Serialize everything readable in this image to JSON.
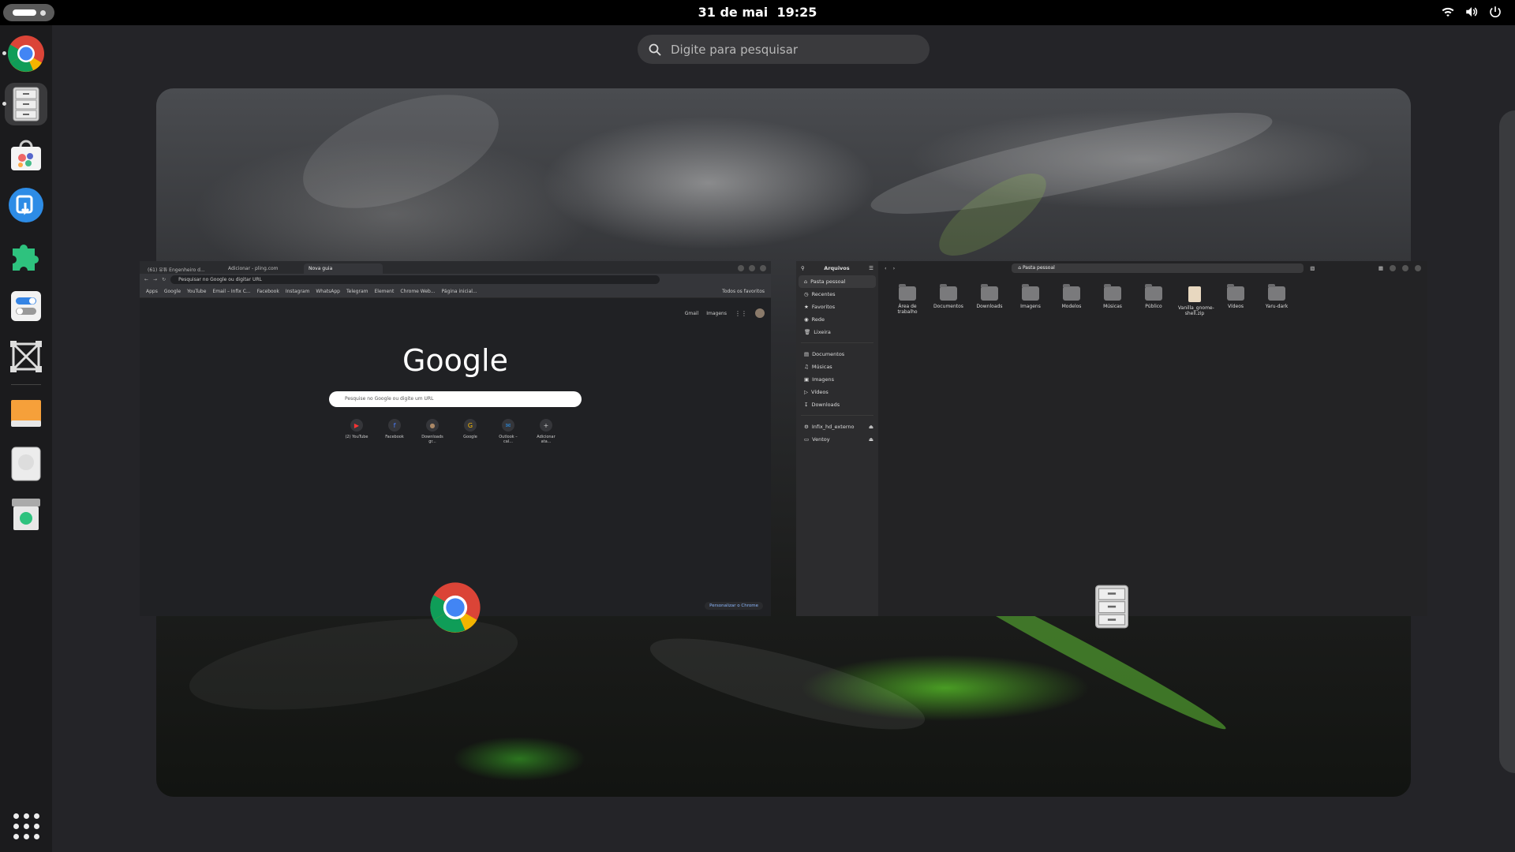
{
  "topbar": {
    "date": "31 de mai",
    "time": "19:25"
  },
  "search": {
    "placeholder": "Digite para pesquisar"
  },
  "dash": {
    "items": [
      {
        "name": "chrome-icon",
        "running": true
      },
      {
        "name": "files-icon",
        "running": true,
        "active": true
      },
      {
        "name": "software-store-icon"
      },
      {
        "name": "screen-recorder-icon"
      },
      {
        "name": "extensions-icon"
      },
      {
        "name": "tweaks-icon"
      },
      {
        "name": "vector-editor-icon"
      },
      {
        "name": "drive-icon"
      },
      {
        "name": "disk-icon"
      },
      {
        "name": "trash-icon"
      }
    ]
  },
  "chrome": {
    "tabs": [
      "(61) 유튜 Engenheiro d...",
      "Adicionar - pling.com",
      "Nova guia"
    ],
    "omnibox": "Pesquisar no Google ou digitar URL",
    "bookmarks": [
      "Apps",
      "Google",
      "YouTube",
      "Email – Infix C...",
      "Facebook",
      "Instagram",
      "WhatsApp",
      "Telegram",
      "Element",
      "Chrome Web...",
      "Página inicial..."
    ],
    "all_bookmarks": "Todos os favoritos",
    "top_links": [
      "Gmail",
      "Imagens"
    ],
    "logo": "Google",
    "search_placeholder": "Pesquise no Google ou digite um URL",
    "shortcuts": [
      "(2) YouTube",
      "Facebook",
      "Downloads gr...",
      "Google",
      "Outlook – cal...",
      "Adicionar ata..."
    ],
    "customize": "Personalizar o Chrome"
  },
  "files": {
    "title": "Arquivos",
    "path": "Pasta pessoal",
    "sidebar": [
      "Pasta pessoal",
      "Recentes",
      "Favoritos",
      "Rede",
      "Lixeira"
    ],
    "places": [
      "Documentos",
      "Músicas",
      "Imagens",
      "Vídeos",
      "Downloads"
    ],
    "devices": [
      "Infix_hd_externo",
      "Ventoy"
    ],
    "items": [
      "Área de trabalho",
      "Documentos",
      "Downloads",
      "Imagens",
      "Modelos",
      "Músicas",
      "Público",
      "Vanilla_gnome-shell.zip",
      "Vídeos",
      "Yaru-dark"
    ]
  }
}
